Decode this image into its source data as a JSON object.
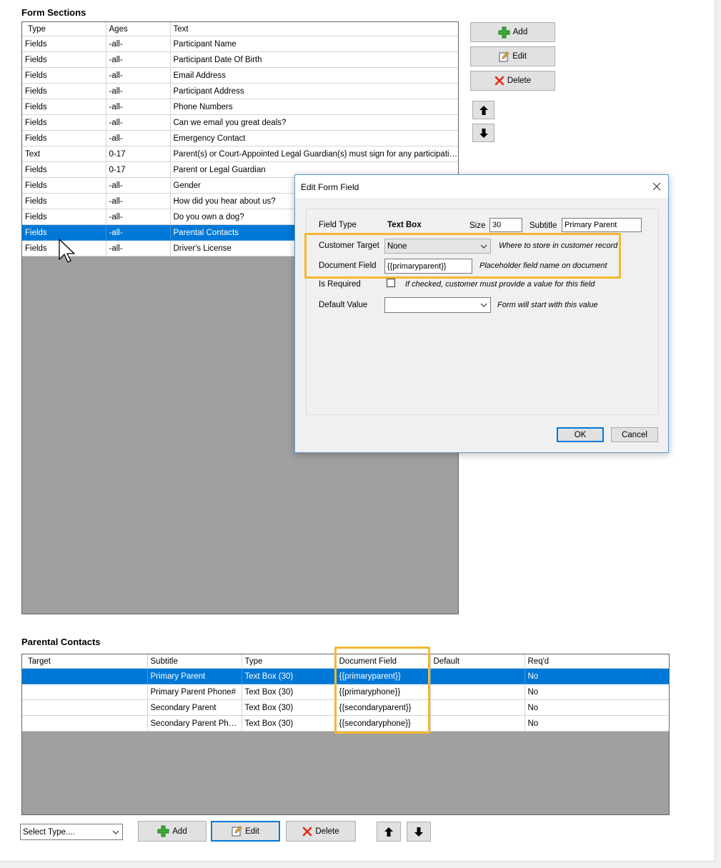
{
  "form_sections": {
    "title": "Form Sections",
    "columns": [
      "Type",
      "Ages",
      "Text"
    ],
    "selected_index": 12,
    "rows": [
      [
        "Fields",
        "-all-",
        "Participant Name"
      ],
      [
        "Fields",
        "-all-",
        "Participant Date Of Birth"
      ],
      [
        "Fields",
        "-all-",
        "Email Address"
      ],
      [
        "Fields",
        "-all-",
        "Participant Address"
      ],
      [
        "Fields",
        "-all-",
        "Phone Numbers"
      ],
      [
        "Fields",
        "-all-",
        "Can we email you great deals?"
      ],
      [
        "Fields",
        "-all-",
        "Emergency Contact"
      ],
      [
        "Text",
        "0-17",
        "Parent(s) or Court-Appointed Legal Guardian(s) must sign for any participating min..."
      ],
      [
        "Fields",
        "0-17",
        "Parent or Legal Guardian"
      ],
      [
        "Fields",
        "-all-",
        "Gender"
      ],
      [
        "Fields",
        "-all-",
        "How did you hear about us?"
      ],
      [
        "Fields",
        "-all-",
        "Do you own a dog?"
      ],
      [
        "Fields",
        "-all-",
        "Parental Contacts"
      ],
      [
        "Fields",
        "-all-",
        "Driver's License"
      ]
    ]
  },
  "side_buttons": {
    "add": "Add",
    "edit": "Edit",
    "delete": "Delete"
  },
  "dialog": {
    "title": "Edit Form Field",
    "field_type_label": "Field Type",
    "field_type_value": "Text Box",
    "size_label": "Size",
    "size_value": "30",
    "subtitle_label": "Subtitle",
    "subtitle_value": "Primary Parent",
    "customer_target_label": "Customer Target",
    "customer_target_value": "None",
    "customer_target_hint": "Where to store in customer record",
    "document_field_label": "Document Field",
    "document_field_value": "{{primaryparent}}",
    "document_field_hint": "Placeholder field name on document",
    "is_required_label": "Is Required",
    "is_required_checked": false,
    "is_required_hint": "If checked, customer must provide a value for this field",
    "default_value_label": "Default Value",
    "default_value_value": "",
    "default_value_hint": "Form will start with this value",
    "ok_label": "OK",
    "cancel_label": "Cancel"
  },
  "parental_contacts": {
    "title": "Parental Contacts",
    "columns": [
      "Target",
      "Subtitle",
      "Type",
      "Document Field",
      "Default",
      "Req'd"
    ],
    "selected_index": 0,
    "rows": [
      [
        "",
        "Primary Parent",
        "Text Box (30)",
        "{{primaryparent}}",
        "",
        "No"
      ],
      [
        "",
        "Primary Parent Phone#",
        "Text Box (30)",
        "{{primaryphone}}",
        "",
        "No"
      ],
      [
        "",
        "Secondary Parent",
        "Text Box (30)",
        "{{secondaryparent}}",
        "",
        "No"
      ],
      [
        "",
        "Secondary Parent Phone",
        "Text Box (30)",
        "{{secondaryphone}}",
        "",
        "No"
      ]
    ]
  },
  "bottom_bar": {
    "select_type": "Select Type....",
    "add": "Add",
    "edit": "Edit",
    "delete": "Delete"
  },
  "colors": {
    "selection": "#0078d7",
    "highlight": "#f5b731",
    "empty_grid": "#a0a0a0"
  }
}
